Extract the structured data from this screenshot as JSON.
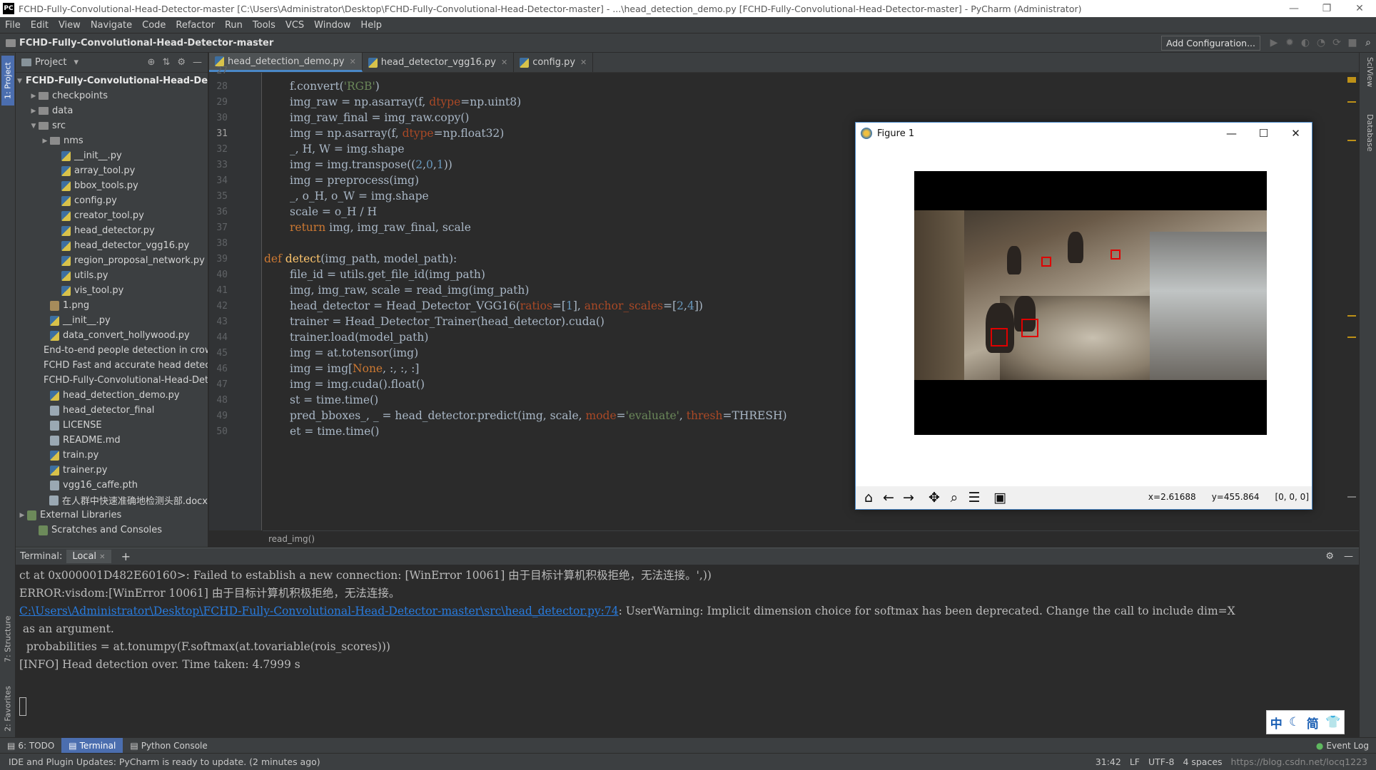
{
  "window": {
    "title": "FCHD-Fully-Convolutional-Head-Detector-master [C:\\Users\\Administrator\\Desktop\\FCHD-Fully-Convolutional-Head-Detector-master] - ...\\head_detection_demo.py [FCHD-Fully-Convolutional-Head-Detector-master] - PyCharm (Administrator)",
    "logo": "PC"
  },
  "menu": [
    "File",
    "Edit",
    "View",
    "Navigate",
    "Code",
    "Refactor",
    "Run",
    "Tools",
    "VCS",
    "Window",
    "Help"
  ],
  "navbar": {
    "project_name": "FCHD-Fully-Convolutional-Head-Detector-master",
    "add_configuration": "Add Configuration..."
  },
  "left_strip": {
    "project_tab": "1: Project",
    "structure_tab": "7: Structure",
    "favorites_tab": "2: Favorites"
  },
  "right_strip": {
    "sciview": "SciView",
    "database": "Database"
  },
  "project_panel": {
    "header": "Project",
    "tree": [
      {
        "label": "FCHD-Fully-Convolutional-Head-Dete",
        "type": "folder",
        "depth": 0,
        "expanded": true,
        "root": true
      },
      {
        "label": "checkpoints",
        "type": "folder",
        "depth": 1,
        "expanded": false
      },
      {
        "label": "data",
        "type": "folder",
        "depth": 1,
        "expanded": false
      },
      {
        "label": "src",
        "type": "folder",
        "depth": 1,
        "expanded": true
      },
      {
        "label": "nms",
        "type": "folder",
        "depth": 2,
        "expanded": false
      },
      {
        "label": "__init__.py",
        "type": "py",
        "depth": 3
      },
      {
        "label": "array_tool.py",
        "type": "py",
        "depth": 3
      },
      {
        "label": "bbox_tools.py",
        "type": "py",
        "depth": 3
      },
      {
        "label": "config.py",
        "type": "py",
        "depth": 3
      },
      {
        "label": "creator_tool.py",
        "type": "py",
        "depth": 3
      },
      {
        "label": "head_detector.py",
        "type": "py",
        "depth": 3
      },
      {
        "label": "head_detector_vgg16.py",
        "type": "py",
        "depth": 3
      },
      {
        "label": "region_proposal_network.py",
        "type": "py",
        "depth": 3
      },
      {
        "label": "utils.py",
        "type": "py",
        "depth": 3
      },
      {
        "label": "vis_tool.py",
        "type": "py",
        "depth": 3
      },
      {
        "label": "1.png",
        "type": "img",
        "depth": 2
      },
      {
        "label": "__init__.py",
        "type": "py",
        "depth": 2
      },
      {
        "label": "data_convert_hollywood.py",
        "type": "py",
        "depth": 2
      },
      {
        "label": "End-to-end people detection in crow",
        "type": "doc",
        "depth": 2
      },
      {
        "label": "FCHD Fast and accurate head detect",
        "type": "doc",
        "depth": 2
      },
      {
        "label": "FCHD-Fully-Convolutional-Head-Dete",
        "type": "doc",
        "depth": 2
      },
      {
        "label": "head_detection_demo.py",
        "type": "py",
        "depth": 2
      },
      {
        "label": "head_detector_final",
        "type": "doc",
        "depth": 2
      },
      {
        "label": "LICENSE",
        "type": "doc",
        "depth": 2
      },
      {
        "label": "README.md",
        "type": "doc",
        "depth": 2
      },
      {
        "label": "train.py",
        "type": "py",
        "depth": 2
      },
      {
        "label": "trainer.py",
        "type": "py",
        "depth": 2
      },
      {
        "label": "vgg16_caffe.pth",
        "type": "doc",
        "depth": 2
      },
      {
        "label": "在人群中快速准确地检测头部.docx",
        "type": "doc",
        "depth": 2
      },
      {
        "label": "External Libraries",
        "type": "lib",
        "depth": 0,
        "expanded": false
      },
      {
        "label": "Scratches and Consoles",
        "type": "lib",
        "depth": 1
      }
    ]
  },
  "editor": {
    "tabs": [
      {
        "label": "head_detection_demo.py",
        "active": true
      },
      {
        "label": "head_detector_vgg16.py",
        "active": false
      },
      {
        "label": "config.py",
        "active": false
      }
    ],
    "current_line": "31",
    "lines": [
      {
        "n": "27",
        "indent": 0,
        "tokens": []
      },
      {
        "n": "28",
        "indent": 1,
        "tokens": [
          [
            "t",
            "f.convert("
          ],
          [
            "str",
            "'RGB'"
          ],
          [
            "t",
            ")"
          ]
        ]
      },
      {
        "n": "29",
        "indent": 1,
        "tokens": [
          [
            "t",
            "img_raw = np.asarray(f, "
          ],
          [
            "prm",
            "dtype"
          ],
          [
            "t",
            "=np.uint8)"
          ]
        ]
      },
      {
        "n": "30",
        "indent": 1,
        "tokens": [
          [
            "t",
            "img_raw_final = img_raw.copy()"
          ]
        ]
      },
      {
        "n": "31",
        "indent": 1,
        "tokens": [
          [
            "t",
            "img = np.asarray(f, "
          ],
          [
            "prm",
            "dtype"
          ],
          [
            "t",
            "=np.float32)"
          ]
        ]
      },
      {
        "n": "32",
        "indent": 1,
        "tokens": [
          [
            "t",
            "_, H, W = img.shape"
          ]
        ]
      },
      {
        "n": "33",
        "indent": 1,
        "tokens": [
          [
            "t",
            "img = img.transpose(("
          ],
          [
            "num",
            "2"
          ],
          [
            "t",
            ","
          ],
          [
            "num",
            "0"
          ],
          [
            "t",
            ","
          ],
          [
            "num",
            "1"
          ],
          [
            "t",
            "))"
          ]
        ]
      },
      {
        "n": "34",
        "indent": 1,
        "tokens": [
          [
            "t",
            "img = preprocess(img)"
          ]
        ]
      },
      {
        "n": "35",
        "indent": 1,
        "tokens": [
          [
            "t",
            "_, o_H, o_W = img.shape"
          ]
        ]
      },
      {
        "n": "36",
        "indent": 1,
        "tokens": [
          [
            "t",
            "scale = o_H / H"
          ]
        ]
      },
      {
        "n": "37",
        "indent": 1,
        "tokens": [
          [
            "kw",
            "return"
          ],
          [
            "t",
            " img, img_raw_final, scale"
          ]
        ]
      },
      {
        "n": "38",
        "indent": 0,
        "tokens": []
      },
      {
        "n": "39",
        "indent": 0,
        "tokens": [
          [
            "kw",
            "def"
          ],
          [
            "t",
            " "
          ],
          [
            "fn",
            "detect"
          ],
          [
            "t",
            "(img_path, model_path):"
          ]
        ]
      },
      {
        "n": "40",
        "indent": 1,
        "tokens": [
          [
            "t",
            "file_id = utils.get_file_id(img_path)"
          ]
        ]
      },
      {
        "n": "41",
        "indent": 1,
        "tokens": [
          [
            "t",
            "img, img_raw, scale = read_img(img_path)"
          ]
        ]
      },
      {
        "n": "42",
        "indent": 1,
        "tokens": [
          [
            "t",
            "head_detector = Head_Detector_VGG16("
          ],
          [
            "prm",
            "ratios"
          ],
          [
            "t",
            "=["
          ],
          [
            "num",
            "1"
          ],
          [
            "t",
            "], "
          ],
          [
            "prm",
            "anchor_scales"
          ],
          [
            "t",
            "=["
          ],
          [
            "num",
            "2"
          ],
          [
            "t",
            ","
          ],
          [
            "num",
            "4"
          ],
          [
            "t",
            "])"
          ]
        ]
      },
      {
        "n": "43",
        "indent": 1,
        "tokens": [
          [
            "t",
            "trainer = Head_Detector_Trainer(head_detector).cuda()"
          ]
        ]
      },
      {
        "n": "44",
        "indent": 1,
        "tokens": [
          [
            "t",
            "trainer.load(model_path)"
          ]
        ]
      },
      {
        "n": "45",
        "indent": 1,
        "tokens": [
          [
            "t",
            "img = at.totensor(img)"
          ]
        ]
      },
      {
        "n": "46",
        "indent": 1,
        "tokens": [
          [
            "t",
            "img = img["
          ],
          [
            "kw",
            "None"
          ],
          [
            "t",
            ", :, :, :]"
          ]
        ]
      },
      {
        "n": "47",
        "indent": 1,
        "tokens": [
          [
            "t",
            "img = img.cuda().float()"
          ]
        ]
      },
      {
        "n": "48",
        "indent": 1,
        "tokens": [
          [
            "t",
            "st = time.time()"
          ]
        ]
      },
      {
        "n": "49",
        "indent": 1,
        "tokens": [
          [
            "t",
            "pred_bboxes_, _ = head_detector.predict(img, scale, "
          ],
          [
            "prm",
            "mode"
          ],
          [
            "t",
            "="
          ],
          [
            "str",
            "'evaluate'"
          ],
          [
            "t",
            ", "
          ],
          [
            "prm",
            "thresh"
          ],
          [
            "t",
            "=THRESH)"
          ]
        ]
      },
      {
        "n": "50",
        "indent": 1,
        "tokens": [
          [
            "t",
            "et = time.time()"
          ]
        ]
      }
    ],
    "breadcrumb": "read_img()"
  },
  "terminal": {
    "label": "Terminal:",
    "tab": "Local",
    "lines": [
      {
        "text": "ct at 0x000001D482E60160>: Failed to establish a new connection: [WinError 10061] 由于目标计算机积极拒绝，无法连接。',))"
      },
      {
        "text": "ERROR:visdom:[WinError 10061] 由于目标计算机积极拒绝，无法连接。"
      },
      {
        "link": "C:\\Users\\Administrator\\Desktop\\FCHD-Fully-Convolutional-Head-Detector-master\\src\\head_detector.py:74",
        "text": ": UserWarning: Implicit dimension choice for softmax has been deprecated. Change the call to include dim=X"
      },
      {
        "text": " as an argument."
      },
      {
        "text": "  probabilities = at.tonumpy(F.softmax(at.tovariable(rois_scores)))"
      },
      {
        "text": "[INFO] Head detection over. Time taken: 4.7999 s"
      }
    ],
    "ime": [
      "中",
      "☾",
      "简",
      "👕"
    ]
  },
  "bottom_tabs": [
    {
      "label": "6: TODO",
      "active": false
    },
    {
      "label": "Terminal",
      "active": true
    },
    {
      "label": "Python Console",
      "active": false
    }
  ],
  "event_log": "Event Log",
  "status": {
    "message": "IDE and Plugin Updates: PyCharm is ready to update. (2 minutes ago)",
    "position": "31:42",
    "line_sep": "LF",
    "encoding": "UTF-8",
    "indent": "4 spaces",
    "watermark": "https://blog.csdn.net/locq1223"
  },
  "figure": {
    "title": "Figure 1",
    "coords": {
      "x": "x=2.61688",
      "y": "y=455.864",
      "rgb": "[0, 0, 0]"
    },
    "box_color": "#e00000"
  }
}
